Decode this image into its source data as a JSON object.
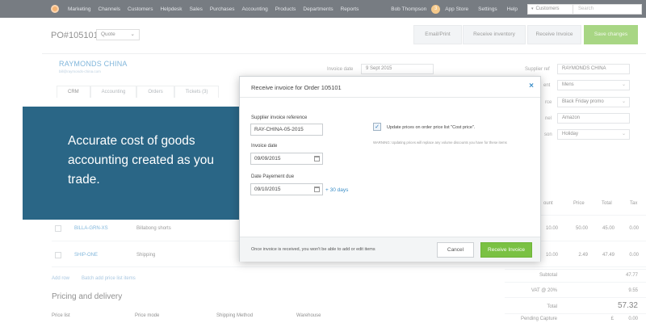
{
  "topnav": {
    "items": [
      "Marketing",
      "Channels",
      "Customers",
      "Helpdesk",
      "Sales",
      "Purchases",
      "Accounting",
      "Products",
      "Departments",
      "Reports"
    ],
    "user": "Bob Thompson",
    "badge_count": "3",
    "app_store": "App Store",
    "settings": "Settings",
    "help": "Help",
    "search_scope": "Customers",
    "search_placeholder": "Search"
  },
  "header": {
    "po_number": "PO#105101",
    "status_select": "Quote",
    "email_print": "Email/Print",
    "receive_inventory": "Receive inventory",
    "receive_invoice": "Receive Invoice",
    "save_changes": "Save changes"
  },
  "supplier": {
    "name": "RAYMONDS CHINA",
    "email": "bill@raymonds-china.com",
    "tabs": [
      "CRM",
      "Accounting",
      "Orders",
      "Tickets (3)"
    ]
  },
  "fields": {
    "invoice_date_label": "Invoice date",
    "invoice_date_value": "9 Sept 2015",
    "supplier_ref_label": "Supplier ref",
    "supplier_ref_value": "RAYMONDS CHINA",
    "row2_label": "ent",
    "row2_value": "Mens",
    "row3_label": "rce",
    "row3_value": "Black Friday promo",
    "row4_label": "nel",
    "row4_value": "Amazon",
    "row5_label": "son",
    "row5_value": "Holiday"
  },
  "table": {
    "headers": {
      "discount": "ount",
      "price": "Price",
      "total": "Total",
      "tax": "Tax"
    },
    "rows": [
      {
        "sku": "BILLA-GRN-XS",
        "description": "Billabong shorts",
        "discount": "10.00",
        "price": "50.00",
        "total": "45.00",
        "tax": "0.00"
      },
      {
        "sku": "SHIP-ONE",
        "description": "Shipping",
        "discount": "10.00",
        "price": "2.49",
        "total": "47.49",
        "tax": "0.00"
      }
    ],
    "add_row": "Add row",
    "batch_add": "Batch add price list items"
  },
  "pricing": {
    "title": "Pricing and delivery",
    "columns": [
      "Price list",
      "Price mode",
      "Shipping Method",
      "Warehouse"
    ]
  },
  "totals": {
    "subtotal_label": "Subtotal",
    "subtotal_value": "47.77",
    "vat_label": "VAT @ 20%",
    "vat_value": "9.55",
    "total_label": "Total",
    "total_value": "57.32",
    "pending_label": "Pending Capture",
    "pending_currency": "£",
    "pending_value": "0.00"
  },
  "callout": {
    "text": "Accurate cost of goods accounting created as you trade."
  },
  "modal": {
    "title": "Receive invoice for Order 105101",
    "close": "×",
    "ref_label": "Supplier invoice reference",
    "ref_value": "RAY-CHINA-05-2015",
    "date_label": "Invoice date",
    "date_value": "09/09/2015",
    "due_label": "Date Payement due",
    "due_value": "09/10/2015",
    "plus_30": "+ 30 days",
    "check_mark": "✓",
    "update_prices": "Update prices on order price list \"Cost price\".",
    "warning": "WARNING: Updating prices will replace any volume discounts you have for these items",
    "footer_text": "Once invoice is received, you won't be able to add or edit items",
    "cancel": "Cancel",
    "submit": "Receive Invoice"
  },
  "colors": {
    "nav_bg": "#2f3640",
    "accent_blue": "#3d8fc8",
    "callout_bg": "#2a6686",
    "green": "#7ac143",
    "badge": "#f0ad4e"
  }
}
